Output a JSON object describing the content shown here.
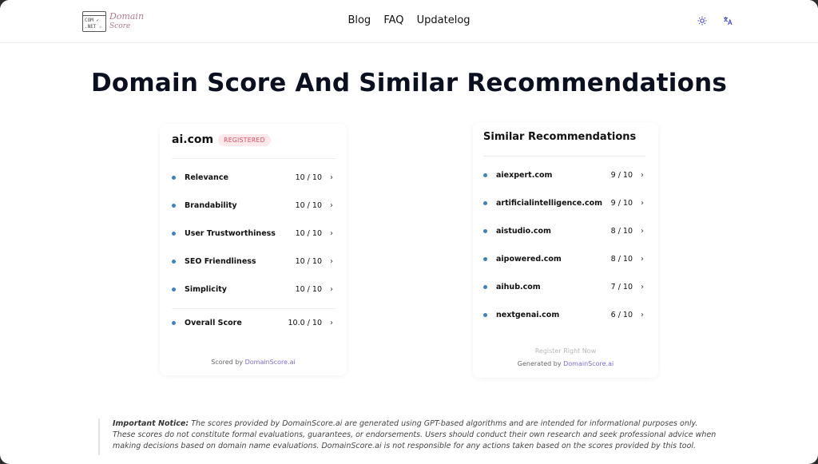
{
  "header": {
    "logo": {
      "box_line1": "COM ✓",
      "box_line2": ".NET ☆",
      "word1": "Domain",
      "word2": "Score"
    },
    "nav": [
      "Blog",
      "FAQ",
      "Updatelog"
    ],
    "icons": {
      "theme": "sun-icon",
      "language": "translate-icon"
    },
    "accent": "#4c4cd6"
  },
  "page_title": "Domain Score And Similar Recommendations",
  "score_card": {
    "domain": "ai.com",
    "badge": "REGISTERED",
    "metrics": [
      {
        "label": "Relevance",
        "value": "10 / 10"
      },
      {
        "label": "Brandability",
        "value": "10 / 10"
      },
      {
        "label": "User Trustworthiness",
        "value": "10 / 10"
      },
      {
        "label": "SEO Friendliness",
        "value": "10 / 10"
      },
      {
        "label": "Simplicity",
        "value": "10 / 10"
      }
    ],
    "overall": {
      "label": "Overall Score",
      "value": "10.0 / 10"
    },
    "footer_prefix": "Scored by",
    "footer_link": "DomainScore.ai"
  },
  "recommendations": {
    "title": "Similar Recommendations",
    "items": [
      {
        "domain": "aiexpert.com",
        "score": "9 / 10"
      },
      {
        "domain": "artificialintelligence.com",
        "score": "9 / 10"
      },
      {
        "domain": "aistudio.com",
        "score": "8 / 10"
      },
      {
        "domain": "aipowered.com",
        "score": "8 / 10"
      },
      {
        "domain": "aihub.com",
        "score": "7 / 10"
      },
      {
        "domain": "nextgenai.com",
        "score": "6 / 10"
      }
    ],
    "register_label": "Register Right Now",
    "footer_prefix": "Generated by",
    "footer_link": "DomainScore.ai"
  },
  "notice": {
    "heading": "Important Notice:",
    "text": "The scores provided by DomainScore.ai are generated using GPT-based algorithms and are intended for informational purposes only. These scores do not constitute formal evaluations, guarantees, or endorsements. Users should conduct their own research and seek professional advice when making decisions based on domain name evaluations. DomainScore.ai is not responsible for any actions taken based on the scores provided by this tool."
  },
  "colors": {
    "dot": "#3b82c4",
    "badge_bg": "#fde8ea",
    "badge_text": "#d9485f",
    "link": "#7c6cd6"
  }
}
